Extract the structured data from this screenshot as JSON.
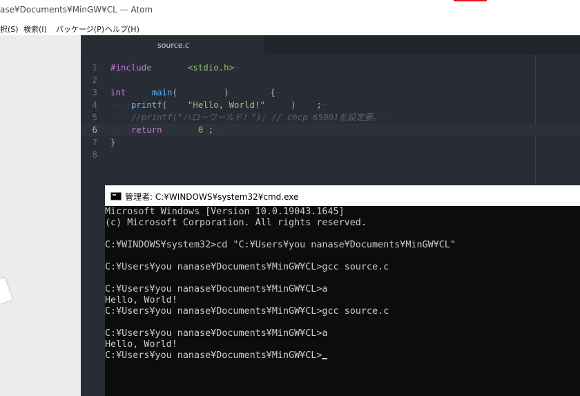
{
  "atom": {
    "title": "ase¥Documents¥MinGW¥CL — Atom",
    "menu": [
      "択(S)",
      "検索(I)",
      "パッケージ(P)",
      "ヘルプ(H)"
    ],
    "tab": "source.c",
    "lines": [
      {
        "num": "1",
        "tokens": [
          {
            "t": "#include",
            "c": "k"
          },
          {
            "t": "       ",
            "c": "p"
          },
          {
            "t": "<stdio.h>",
            "c": "s"
          },
          {
            "t": "¬",
            "c": "inv"
          }
        ]
      },
      {
        "num": "2",
        "tokens": [
          {
            "t": "¬",
            "c": "inv"
          }
        ]
      },
      {
        "num": "3",
        "tokens": [
          {
            "t": "int",
            "c": "k"
          },
          {
            "t": "     ",
            "c": "p"
          },
          {
            "t": "main",
            "c": "f"
          },
          {
            "t": "(         )        {",
            "c": "p"
          },
          {
            "t": "¬",
            "c": "inv"
          }
        ]
      },
      {
        "num": "4",
        "tokens": [
          {
            "t": "····",
            "c": "inv"
          },
          {
            "t": "printf",
            "c": "f"
          },
          {
            "t": "(    ",
            "c": "p"
          },
          {
            "t": "\"Hello, World!\"",
            "c": "s"
          },
          {
            "t": "     )    ;",
            "c": "p"
          },
          {
            "t": "¬",
            "c": "inv"
          }
        ]
      },
      {
        "num": "5",
        "tokens": [
          {
            "t": "····",
            "c": "inv"
          },
          {
            "t": "//printf(\"ハローワールド！\"); // chcp 65001を設定要。",
            "c": "c"
          },
          {
            "t": "¬",
            "c": "inv"
          }
        ]
      },
      {
        "num": "6",
        "tokens": [
          {
            "t": "····",
            "c": "inv"
          },
          {
            "t": "return",
            "c": "k"
          },
          {
            "t": "       ",
            "c": "p"
          },
          {
            "t": "0",
            "c": "n"
          },
          {
            "t": " ;",
            "c": "p"
          },
          {
            "t": "¬",
            "c": "inv"
          }
        ]
      },
      {
        "num": "7",
        "tokens": [
          {
            "t": "}",
            "c": "p"
          },
          {
            "t": "¬",
            "c": "inv"
          }
        ]
      },
      {
        "num": "8",
        "tokens": []
      }
    ],
    "current_line": "6"
  },
  "cmd": {
    "title": "管理者: C:¥WINDOWS¥system32¥cmd.exe",
    "lines": [
      "Microsoft Windows [Version 10.0.19043.1645]",
      "(c) Microsoft Corporation. All rights reserved.",
      "",
      "C:¥WINDOWS¥system32>cd \"C:¥Users¥you nanase¥Documents¥MinGW¥CL\"",
      "",
      "C:¥Users¥you nanase¥Documents¥MinGW¥CL>gcc source.c",
      "",
      "C:¥Users¥you nanase¥Documents¥MinGW¥CL>a",
      "Hello, World!",
      "C:¥Users¥you nanase¥Documents¥MinGW¥CL>gcc source.c",
      "",
      "C:¥Users¥you nanase¥Documents¥MinGW¥CL>a",
      "Hello, World!",
      "C:¥Users¥you nanase¥Documents¥MinGW¥CL>"
    ]
  }
}
